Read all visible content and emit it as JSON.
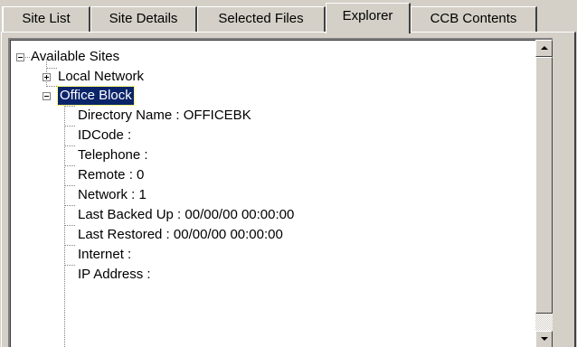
{
  "tabs": [
    {
      "label": "Site List",
      "selected": false
    },
    {
      "label": "Site Details",
      "selected": false
    },
    {
      "label": "Selected Files",
      "selected": false
    },
    {
      "label": "Explorer",
      "selected": true
    },
    {
      "label": "CCB Contents",
      "selected": false
    }
  ],
  "tree": {
    "root": {
      "label": "Available Sites",
      "expanded": true
    },
    "sites": [
      {
        "label": "Local Network",
        "expanded": false
      },
      {
        "label": "Office Block",
        "expanded": true,
        "selected": true
      }
    ],
    "details": [
      "Directory Name : OFFICEBK",
      "IDCode :",
      "Telephone :",
      "Remote : 0",
      "Network : 1",
      "Last Backed Up : 00/00/00 00:00:00",
      "Last Restored : 00/00/00 00:00:00",
      "Internet :",
      "IP Address :"
    ]
  },
  "scrollbar": {
    "up_icon": "arrow-up-icon",
    "down_icon": "arrow-down-icon"
  },
  "colors": {
    "selection_bg": "#0a246a",
    "face": "#d4d0c8"
  }
}
